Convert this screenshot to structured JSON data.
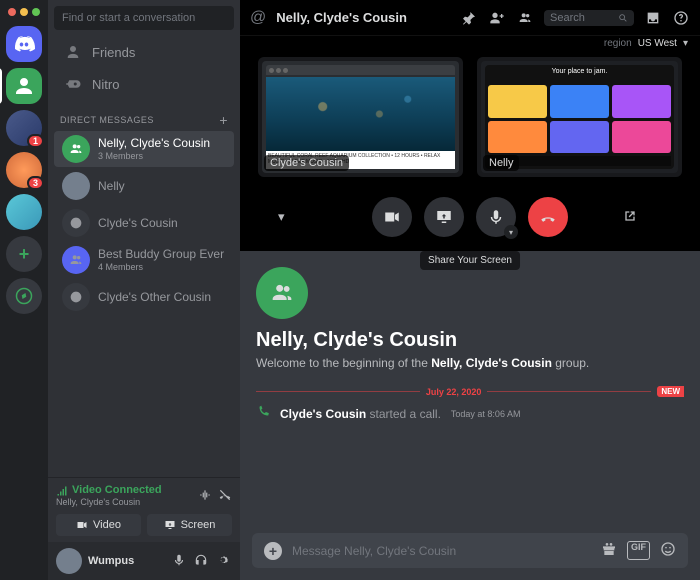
{
  "servers": {
    "badges": {
      "s2": "1",
      "s3": "3"
    }
  },
  "sidebar": {
    "find_placeholder": "Find or start a conversation",
    "friends_label": "Friends",
    "nitro_label": "Nitro",
    "dm_header": "DIRECT MESSAGES",
    "dms": [
      {
        "name": "Nelly, Clyde's Cousin",
        "sub": "3 Members"
      },
      {
        "name": "Nelly",
        "sub": ""
      },
      {
        "name": "Clyde's Cousin",
        "sub": ""
      },
      {
        "name": "Best Buddy Group Ever",
        "sub": "4 Members"
      },
      {
        "name": "Clyde's Other Cousin",
        "sub": ""
      }
    ],
    "voice": {
      "status": "Video Connected",
      "channel": "Nelly, Clyde's Cousin",
      "video_btn": "Video",
      "screen_btn": "Screen"
    },
    "user": {
      "name": "Wumpus"
    }
  },
  "topbar": {
    "title": "Nelly, Clyde's Cousin",
    "search_placeholder": "Search",
    "region_label": "region",
    "region_value": "US West"
  },
  "call": {
    "tiles": [
      {
        "label": "Clyde's Cousin"
      },
      {
        "label": "Nelly"
      }
    ],
    "tooltip": "Share Your Screen",
    "jam_text": "Your place to jam."
  },
  "chat": {
    "welcome_title": "Nelly, Clyde's Cousin",
    "welcome_pre": "Welcome to the beginning of the ",
    "welcome_bold": "Nelly, Clyde's Cousin",
    "welcome_post": " group.",
    "divider_date": "July 22, 2020",
    "divider_new": "NEW",
    "call_event": {
      "actor": "Clyde's Cousin",
      "text": " started a call.",
      "time": "Today at 8:06 AM"
    },
    "input_placeholder": "Message Nelly, Clyde's Cousin",
    "gif_label": "GIF"
  }
}
